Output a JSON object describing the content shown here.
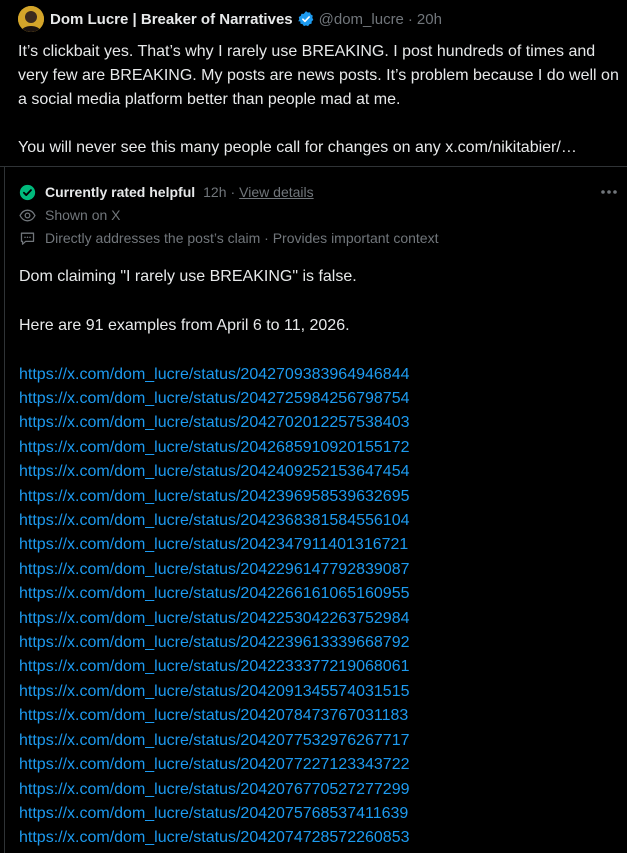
{
  "post": {
    "author": "Dom Lucre | Breaker of Narratives",
    "handle": "@dom_lucre",
    "separator": "·",
    "time": "20h",
    "paragraph1": "It’s clickbait yes. That’s why I rarely use BREAKING. I post hundreds of times and very few are BREAKING. My posts are news posts. It’s problem because I do well on a social media platform better than people mad at me.",
    "paragraph2": "You will never see this many people call for changes on any x.com/nikitabier/…"
  },
  "note": {
    "status": "Currently rated helpful",
    "time": "12h",
    "separator": "·",
    "view_details": "View details",
    "shown_on": "Shown on X",
    "reasons": "Directly addresses the post’s claim · Provides important context",
    "line1": "Dom claiming \"I rarely use BREAKING\" is false.",
    "line2": "Here are 91 examples from April 6 to 11, 2026.",
    "links": [
      "https://x.com/dom_lucre/status/2042709383964946844",
      "https://x.com/dom_lucre/status/2042725984256798754",
      "https://x.com/dom_lucre/status/2042702012257538403",
      "https://x.com/dom_lucre/status/2042685910920155172",
      "https://x.com/dom_lucre/status/2042409252153647454",
      "https://x.com/dom_lucre/status/2042396958539632695",
      "https://x.com/dom_lucre/status/2042368381584556104",
      "https://x.com/dom_lucre/status/2042347911401316721",
      "https://x.com/dom_lucre/status/2042296147792839087",
      "https://x.com/dom_lucre/status/2042266161065160955",
      "https://x.com/dom_lucre/status/2042253042263752984",
      "https://x.com/dom_lucre/status/2042239613339668792",
      "https://x.com/dom_lucre/status/2042233377219068061",
      "https://x.com/dom_lucre/status/2042091345574031515",
      "https://x.com/dom_lucre/status/2042078473767031183",
      "https://x.com/dom_lucre/status/2042077532976267717",
      "https://x.com/dom_lucre/status/2042077227123343722",
      "https://x.com/dom_lucre/status/2042076770527277299",
      "https://x.com/dom_lucre/status/2042075768537411639",
      "https://x.com/dom_lucre/status/2042074728572260853"
    ]
  },
  "colors": {
    "background": "#000000",
    "text": "#e7e9ea",
    "muted": "#71767b",
    "link": "#1d9bf0",
    "verified": "#1d9bf0",
    "helpful": "#00ba7c",
    "border": "#2f3336"
  },
  "icons": {
    "verified": "verified-badge-icon",
    "helpful": "check-circle-icon",
    "shown": "eye-icon",
    "reasons": "comment-icon",
    "more": "more-dots-icon"
  }
}
